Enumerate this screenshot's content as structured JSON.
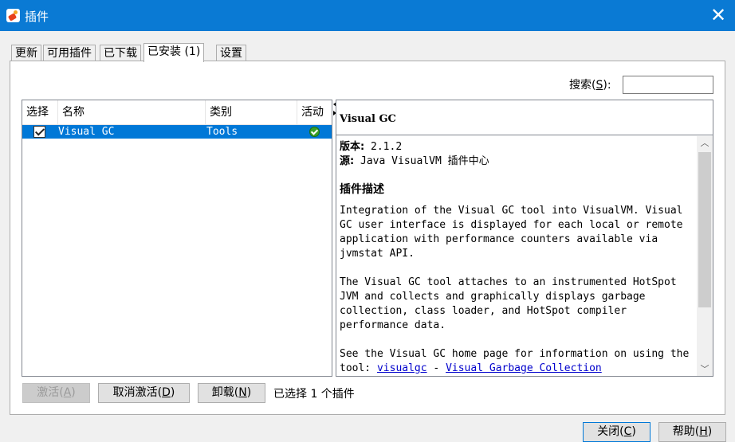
{
  "window": {
    "title": "插件",
    "close_glyph": "✕"
  },
  "tabs": [
    {
      "label": "更新"
    },
    {
      "label": "可用插件"
    },
    {
      "label": "已下载"
    },
    {
      "label": "已安装 (1)",
      "active": true
    },
    {
      "label": "设置"
    }
  ],
  "search": {
    "label_prefix": "搜索(",
    "mnemonic": "S",
    "label_suffix": "):",
    "value": ""
  },
  "table": {
    "headers": [
      "选择",
      "名称",
      "类别",
      "活动"
    ],
    "rows": [
      {
        "selected": true,
        "name": "Visual GC",
        "category": "Tools",
        "active": true
      }
    ]
  },
  "details": {
    "title": "Visual GC",
    "version_label": "版本:",
    "version": "2.1.2",
    "source_label": "源:",
    "source": "Java VisualVM 插件中心",
    "description_heading": "插件描述",
    "paragraph1": "Integration of the Visual GC tool into VisualVM. Visual GC user interface is displayed for each local or remote application with performance counters available via jvmstat API.",
    "paragraph2": "The Visual GC tool attaches to an instrumented HotSpot JVM and collects and graphically displays garbage collection, class loader, and HotSpot compiler performance data.",
    "paragraph3_prefix": "See the Visual GC home page for information on using the tool:",
    "link1": "visualgc",
    "link_sep": " - ",
    "link2": "Visual Garbage Collection"
  },
  "buttons": {
    "activate": {
      "prefix": "激活(",
      "mnemonic": "A",
      "suffix": ")"
    },
    "deactivate": {
      "prefix": "取消激活(",
      "mnemonic": "D",
      "suffix": ")"
    },
    "uninstall": {
      "prefix": "卸载(",
      "mnemonic": "N",
      "suffix": ")"
    },
    "close": {
      "prefix": "关闭(",
      "mnemonic": "C",
      "suffix": ")"
    },
    "help": {
      "prefix": "帮助(",
      "mnemonic": "H",
      "suffix": ")"
    }
  },
  "status": {
    "selected_count": "已选择 1 个插件"
  },
  "colors": {
    "titlebar": "#0a7ad4",
    "selection": "#0078d7",
    "link": "#0000cc"
  }
}
